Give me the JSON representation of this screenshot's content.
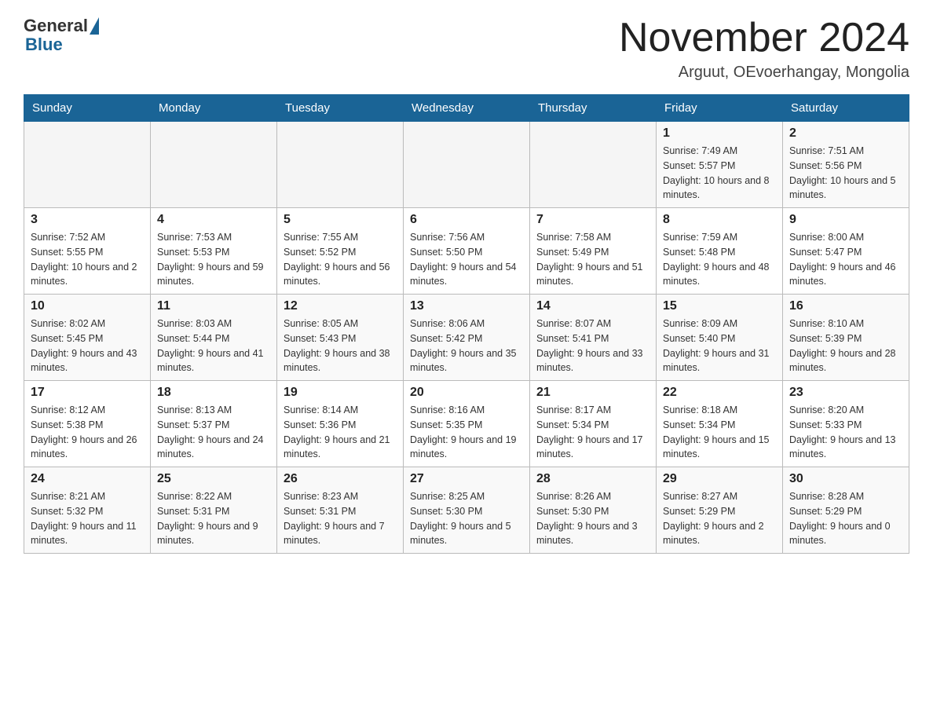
{
  "header": {
    "logo_general": "General",
    "logo_blue": "Blue",
    "main_title": "November 2024",
    "subtitle": "Arguut, OEvoerhangay, Mongolia"
  },
  "calendar": {
    "days_of_week": [
      "Sunday",
      "Monday",
      "Tuesday",
      "Wednesday",
      "Thursday",
      "Friday",
      "Saturday"
    ],
    "weeks": [
      [
        {
          "day": "",
          "info": ""
        },
        {
          "day": "",
          "info": ""
        },
        {
          "day": "",
          "info": ""
        },
        {
          "day": "",
          "info": ""
        },
        {
          "day": "",
          "info": ""
        },
        {
          "day": "1",
          "info": "Sunrise: 7:49 AM\nSunset: 5:57 PM\nDaylight: 10 hours and 8 minutes."
        },
        {
          "day": "2",
          "info": "Sunrise: 7:51 AM\nSunset: 5:56 PM\nDaylight: 10 hours and 5 minutes."
        }
      ],
      [
        {
          "day": "3",
          "info": "Sunrise: 7:52 AM\nSunset: 5:55 PM\nDaylight: 10 hours and 2 minutes."
        },
        {
          "day": "4",
          "info": "Sunrise: 7:53 AM\nSunset: 5:53 PM\nDaylight: 9 hours and 59 minutes."
        },
        {
          "day": "5",
          "info": "Sunrise: 7:55 AM\nSunset: 5:52 PM\nDaylight: 9 hours and 56 minutes."
        },
        {
          "day": "6",
          "info": "Sunrise: 7:56 AM\nSunset: 5:50 PM\nDaylight: 9 hours and 54 minutes."
        },
        {
          "day": "7",
          "info": "Sunrise: 7:58 AM\nSunset: 5:49 PM\nDaylight: 9 hours and 51 minutes."
        },
        {
          "day": "8",
          "info": "Sunrise: 7:59 AM\nSunset: 5:48 PM\nDaylight: 9 hours and 48 minutes."
        },
        {
          "day": "9",
          "info": "Sunrise: 8:00 AM\nSunset: 5:47 PM\nDaylight: 9 hours and 46 minutes."
        }
      ],
      [
        {
          "day": "10",
          "info": "Sunrise: 8:02 AM\nSunset: 5:45 PM\nDaylight: 9 hours and 43 minutes."
        },
        {
          "day": "11",
          "info": "Sunrise: 8:03 AM\nSunset: 5:44 PM\nDaylight: 9 hours and 41 minutes."
        },
        {
          "day": "12",
          "info": "Sunrise: 8:05 AM\nSunset: 5:43 PM\nDaylight: 9 hours and 38 minutes."
        },
        {
          "day": "13",
          "info": "Sunrise: 8:06 AM\nSunset: 5:42 PM\nDaylight: 9 hours and 35 minutes."
        },
        {
          "day": "14",
          "info": "Sunrise: 8:07 AM\nSunset: 5:41 PM\nDaylight: 9 hours and 33 minutes."
        },
        {
          "day": "15",
          "info": "Sunrise: 8:09 AM\nSunset: 5:40 PM\nDaylight: 9 hours and 31 minutes."
        },
        {
          "day": "16",
          "info": "Sunrise: 8:10 AM\nSunset: 5:39 PM\nDaylight: 9 hours and 28 minutes."
        }
      ],
      [
        {
          "day": "17",
          "info": "Sunrise: 8:12 AM\nSunset: 5:38 PM\nDaylight: 9 hours and 26 minutes."
        },
        {
          "day": "18",
          "info": "Sunrise: 8:13 AM\nSunset: 5:37 PM\nDaylight: 9 hours and 24 minutes."
        },
        {
          "day": "19",
          "info": "Sunrise: 8:14 AM\nSunset: 5:36 PM\nDaylight: 9 hours and 21 minutes."
        },
        {
          "day": "20",
          "info": "Sunrise: 8:16 AM\nSunset: 5:35 PM\nDaylight: 9 hours and 19 minutes."
        },
        {
          "day": "21",
          "info": "Sunrise: 8:17 AM\nSunset: 5:34 PM\nDaylight: 9 hours and 17 minutes."
        },
        {
          "day": "22",
          "info": "Sunrise: 8:18 AM\nSunset: 5:34 PM\nDaylight: 9 hours and 15 minutes."
        },
        {
          "day": "23",
          "info": "Sunrise: 8:20 AM\nSunset: 5:33 PM\nDaylight: 9 hours and 13 minutes."
        }
      ],
      [
        {
          "day": "24",
          "info": "Sunrise: 8:21 AM\nSunset: 5:32 PM\nDaylight: 9 hours and 11 minutes."
        },
        {
          "day": "25",
          "info": "Sunrise: 8:22 AM\nSunset: 5:31 PM\nDaylight: 9 hours and 9 minutes."
        },
        {
          "day": "26",
          "info": "Sunrise: 8:23 AM\nSunset: 5:31 PM\nDaylight: 9 hours and 7 minutes."
        },
        {
          "day": "27",
          "info": "Sunrise: 8:25 AM\nSunset: 5:30 PM\nDaylight: 9 hours and 5 minutes."
        },
        {
          "day": "28",
          "info": "Sunrise: 8:26 AM\nSunset: 5:30 PM\nDaylight: 9 hours and 3 minutes."
        },
        {
          "day": "29",
          "info": "Sunrise: 8:27 AM\nSunset: 5:29 PM\nDaylight: 9 hours and 2 minutes."
        },
        {
          "day": "30",
          "info": "Sunrise: 8:28 AM\nSunset: 5:29 PM\nDaylight: 9 hours and 0 minutes."
        }
      ]
    ]
  }
}
